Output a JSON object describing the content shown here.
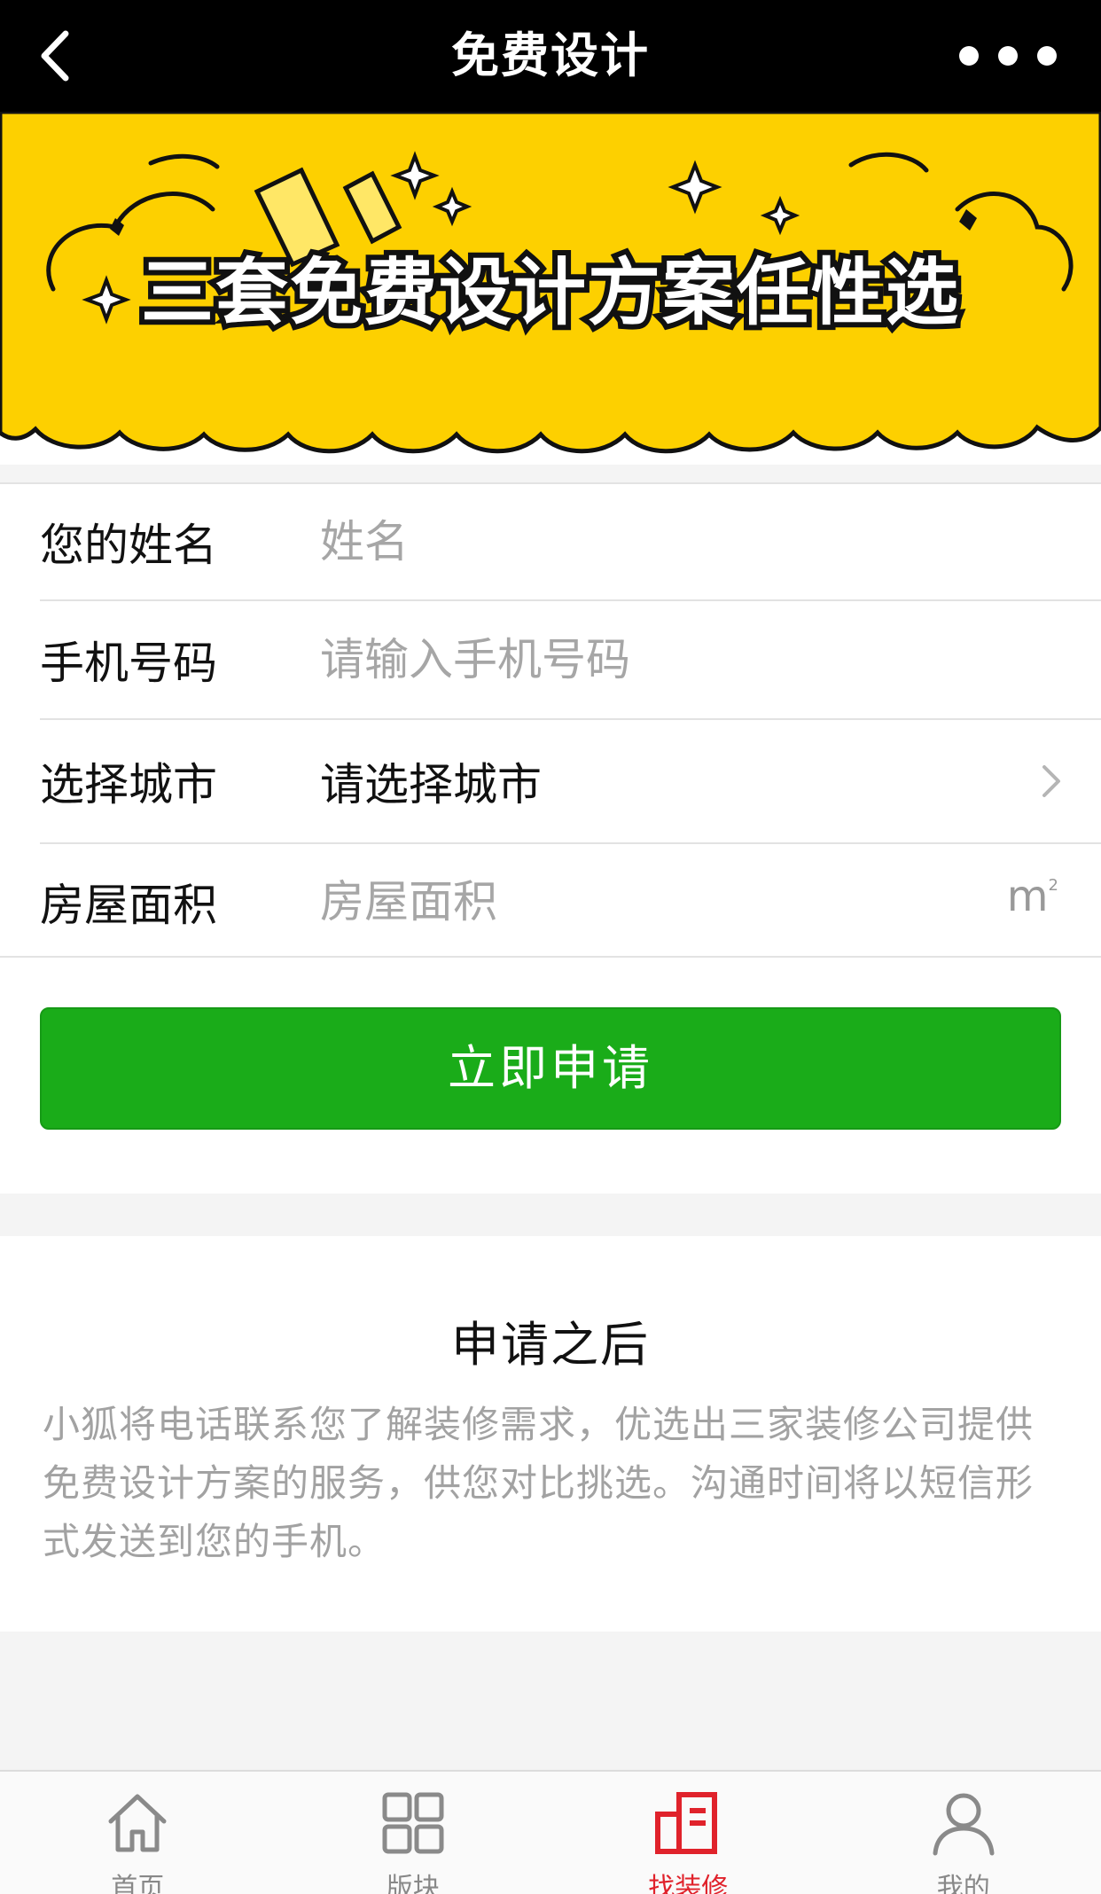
{
  "header": {
    "title": "免费设计"
  },
  "banner": {
    "headline": "三套免费设计方案任性选",
    "colors": {
      "background": "#fdd000",
      "text": "#ffffff",
      "outline": "#111111"
    }
  },
  "form": {
    "rows": [
      {
        "label": "您的姓名",
        "placeholder": "姓名"
      },
      {
        "label": "手机号码",
        "placeholder": "请输入手机号码"
      },
      {
        "label": "选择城市",
        "value": "请选择城市"
      },
      {
        "label": "房屋面积",
        "placeholder": "房屋面积",
        "unit": "m",
        "unit_sup": "2"
      }
    ],
    "submit_label": "立即申请"
  },
  "info": {
    "title": "申请之后",
    "text": "小狐将电话联系您了解装修需求，优选出三家装修公司提供免费设计方案的服务，供您对比挑选。沟通时间将以短信形式发送到您的手机。"
  },
  "tabbar": {
    "items": [
      {
        "label": "首页",
        "icon": "home-icon"
      },
      {
        "label": "版块",
        "icon": "grid-icon"
      },
      {
        "label": "找装修",
        "icon": "building-icon",
        "active": true
      },
      {
        "label": "我的",
        "icon": "user-icon"
      }
    ]
  },
  "colors": {
    "accent_green": "#1aac19",
    "tab_active": "#e0222b",
    "navbar_bg": "#000000"
  }
}
